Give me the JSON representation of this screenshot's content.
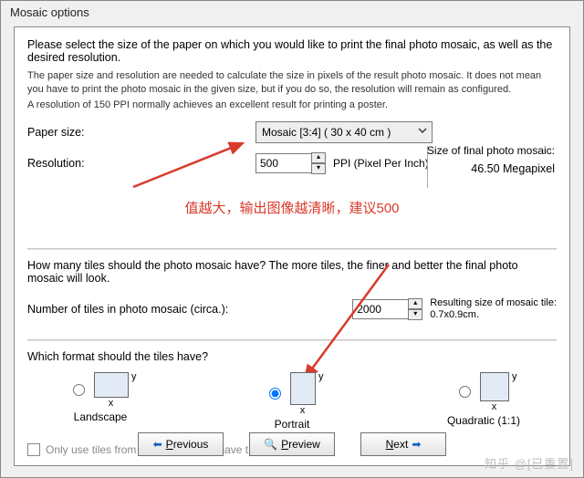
{
  "window": {
    "title": "Mosaic options"
  },
  "intro": "Please select the size of the paper on which you would like to print the final photo mosaic, as well as the desired resolution.",
  "fine1": "The paper size and resolution are needed to calculate the size in pixels of the result photo mosaic. It does not mean you have to print the photo mosaic in the given size, but if you do so, the resolution will remain as configured.",
  "fine2": "A resolution of 150 PPI normally achieves an excellent result for printing a poster.",
  "paper": {
    "label": "Paper size:",
    "value": "Mosaic [3:4]   ( 30 x 40 cm )"
  },
  "resolution": {
    "label": "Resolution:",
    "value": "500",
    "unit": "PPI (Pixel Per Inch)"
  },
  "final_size": {
    "label": "Size of final photo mosaic:",
    "value": "46.50 Megapixel"
  },
  "cn_note": "值越大，输出图像越清晰，建议500",
  "tiles": {
    "question": "How many tiles should the photo mosaic have? The more tiles, the finer and better the final photo mosaic will look.",
    "label": "Number of tiles in photo mosaic (circa.):",
    "value": "2000",
    "result_label": "Resulting size of mosaic tile:",
    "result_value": "0.7x0.9cm."
  },
  "format": {
    "question": "Which format should the tiles have?",
    "landscape": "Landscape",
    "portrait": "Portrait",
    "quadratic": "Quadratic (1:1)",
    "selected": "portrait"
  },
  "only_db": "Only use tiles from database which have this format.",
  "buttons": {
    "previous": "Previous",
    "preview": "Preview",
    "next": "Next",
    "prev_key": "P",
    "preview_key": "P",
    "next_key": "N"
  },
  "watermark": "知乎 @[已重置]"
}
